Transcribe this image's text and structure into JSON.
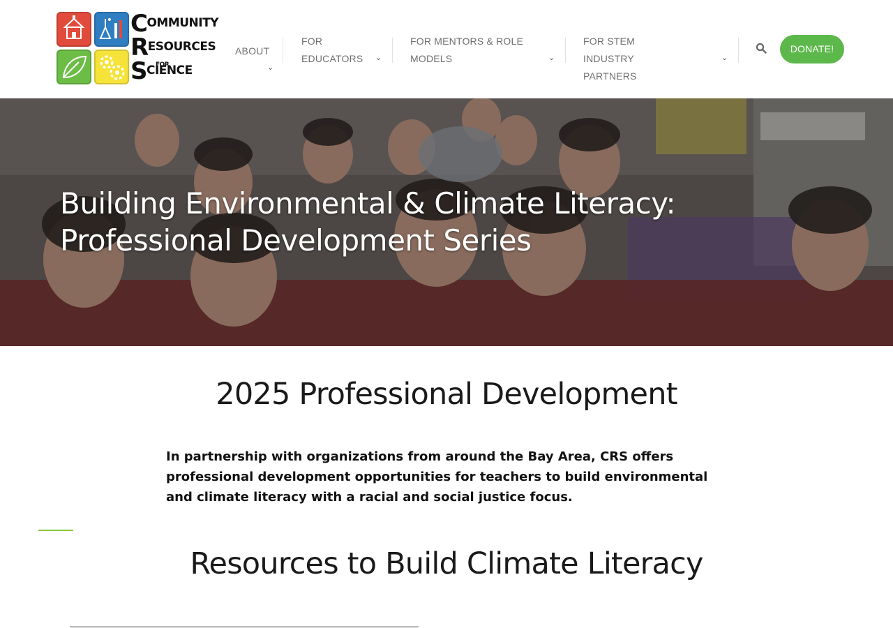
{
  "logo": {
    "line1_big": "C",
    "line1_rest": "OMMUNITY",
    "line2_big": "R",
    "line2_rest": "ESOURCES",
    "line3": "FOR",
    "line4_big": "S",
    "line4_rest": "CIENCE",
    "colors": [
      "#e14b3c",
      "#2f7ec1",
      "#6cbd45",
      "#f6e33a"
    ]
  },
  "nav": {
    "items": [
      {
        "label": "ABOUT",
        "icon": "chevron-down-icon"
      },
      {
        "label": "FOR EDUCATORS",
        "icon": "chevron-down-icon"
      },
      {
        "label": "FOR MENTORS & ROLE MODELS",
        "icon": "chevron-down-icon"
      },
      {
        "label": "FOR STEM INDUSTRY PARTNERS",
        "icon": "chevron-down-icon"
      }
    ],
    "search_icon": "search-icon",
    "donate_label": "DONATE!",
    "donate_color": "#5cb84a"
  },
  "hero": {
    "title": "Building Environmental & Climate Literacy: Professional Development Series"
  },
  "main": {
    "pd_heading": "2025 Professional Development",
    "pd_intro": "In partnership with organizations from around the Bay Area, CRS offers professional development opportunities for teachers to build environmental and climate literacy with a racial and social justice focus.",
    "resources_heading": "Resources to Build Climate Literacy",
    "accent_color": "#8cc63f"
  }
}
